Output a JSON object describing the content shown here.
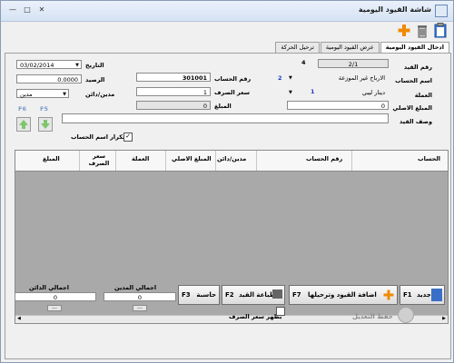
{
  "window": {
    "title": "شاشة القيود اليومية",
    "controls": [
      "minimize-icon",
      "maximize-icon",
      "close-icon"
    ]
  },
  "toolbar": {
    "icons": [
      "clipboard-icon",
      "trash-icon",
      "plus-icon"
    ]
  },
  "tabs": [
    {
      "label": "ادخال القيود اليومية",
      "active": true
    },
    {
      "label": "عرض القيود اليومية",
      "active": false
    },
    {
      "label": "ترحيل الحركة",
      "active": false
    }
  ],
  "form": {
    "entry_no_label": "رقم القيد",
    "entry_no_value": "2/1",
    "entry_no_side": "4",
    "date_label": "التاريخ",
    "date_value": "03/02/2014",
    "account_name_label": "اسم الحساب",
    "account_name_value": "الارباح غير الموزعة",
    "account_name_num": "2",
    "account_no_label": "رقم الحساب",
    "account_no_value": "301001",
    "balance_label": "الرصيد",
    "balance_value": "0.0000",
    "currency_label": "العملة",
    "currency_value": "دينار ليبي",
    "currency_num": "1",
    "exchange_rate_label": "سعر الصرف",
    "exchange_rate_value": "1",
    "debit_credit_label": "مدين/دائن",
    "debit_credit_value": "مدين",
    "original_amount_label": "المبلغ الاصلي",
    "original_amount_value": "0",
    "amount_label": "المبلغ",
    "amount_value": "0",
    "description_label": "وصف القيد",
    "description_value": "",
    "repeat_account_label": "تكرار اسم الحساب",
    "repeat_account_checked": true,
    "f6_label": "F6",
    "f5_label": "F5"
  },
  "grid": {
    "columns": [
      "الحساب",
      "رقم الحساب",
      "مدين/دائن",
      "المبلغ الاصلي",
      "العملة",
      "سعر الصرف",
      "المبلغ"
    ]
  },
  "totals": {
    "total_debit_label": "اجمالي المدين",
    "total_debit_value": "0",
    "total_credit_label": "اجمالي الدائن",
    "total_credit_value": "0",
    "ellipsis": "..."
  },
  "buttons": {
    "new_key": "F1",
    "new_label": "جديد",
    "add_key": "F7",
    "add_label": "اضافة القيود وترحيلها",
    "print_key": "F2",
    "print_label": "طباعة القيد",
    "calc_key": "F3",
    "calc_label": "حاسبة",
    "show_rate_label": "بظهر سعر الصرف",
    "save_edit_label": "حفظ التعديل"
  },
  "colors": {
    "accent_blue": "#1f3fbf",
    "grid_bg": "#a9a9a9",
    "plus_orange": "#f08a00"
  }
}
